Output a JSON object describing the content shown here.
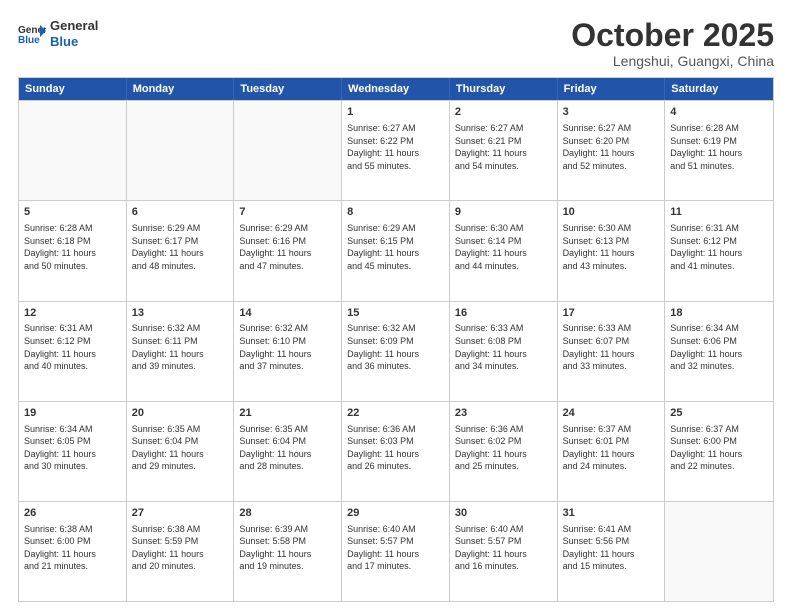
{
  "header": {
    "logo_line1": "General",
    "logo_line2": "Blue",
    "month_title": "October 2025",
    "location": "Lengshui, Guangxi, China"
  },
  "weekdays": [
    "Sunday",
    "Monday",
    "Tuesday",
    "Wednesday",
    "Thursday",
    "Friday",
    "Saturday"
  ],
  "rows": [
    [
      {
        "day": "",
        "info": ""
      },
      {
        "day": "",
        "info": ""
      },
      {
        "day": "",
        "info": ""
      },
      {
        "day": "1",
        "info": "Sunrise: 6:27 AM\nSunset: 6:22 PM\nDaylight: 11 hours\nand 55 minutes."
      },
      {
        "day": "2",
        "info": "Sunrise: 6:27 AM\nSunset: 6:21 PM\nDaylight: 11 hours\nand 54 minutes."
      },
      {
        "day": "3",
        "info": "Sunrise: 6:27 AM\nSunset: 6:20 PM\nDaylight: 11 hours\nand 52 minutes."
      },
      {
        "day": "4",
        "info": "Sunrise: 6:28 AM\nSunset: 6:19 PM\nDaylight: 11 hours\nand 51 minutes."
      }
    ],
    [
      {
        "day": "5",
        "info": "Sunrise: 6:28 AM\nSunset: 6:18 PM\nDaylight: 11 hours\nand 50 minutes."
      },
      {
        "day": "6",
        "info": "Sunrise: 6:29 AM\nSunset: 6:17 PM\nDaylight: 11 hours\nand 48 minutes."
      },
      {
        "day": "7",
        "info": "Sunrise: 6:29 AM\nSunset: 6:16 PM\nDaylight: 11 hours\nand 47 minutes."
      },
      {
        "day": "8",
        "info": "Sunrise: 6:29 AM\nSunset: 6:15 PM\nDaylight: 11 hours\nand 45 minutes."
      },
      {
        "day": "9",
        "info": "Sunrise: 6:30 AM\nSunset: 6:14 PM\nDaylight: 11 hours\nand 44 minutes."
      },
      {
        "day": "10",
        "info": "Sunrise: 6:30 AM\nSunset: 6:13 PM\nDaylight: 11 hours\nand 43 minutes."
      },
      {
        "day": "11",
        "info": "Sunrise: 6:31 AM\nSunset: 6:12 PM\nDaylight: 11 hours\nand 41 minutes."
      }
    ],
    [
      {
        "day": "12",
        "info": "Sunrise: 6:31 AM\nSunset: 6:12 PM\nDaylight: 11 hours\nand 40 minutes."
      },
      {
        "day": "13",
        "info": "Sunrise: 6:32 AM\nSunset: 6:11 PM\nDaylight: 11 hours\nand 39 minutes."
      },
      {
        "day": "14",
        "info": "Sunrise: 6:32 AM\nSunset: 6:10 PM\nDaylight: 11 hours\nand 37 minutes."
      },
      {
        "day": "15",
        "info": "Sunrise: 6:32 AM\nSunset: 6:09 PM\nDaylight: 11 hours\nand 36 minutes."
      },
      {
        "day": "16",
        "info": "Sunrise: 6:33 AM\nSunset: 6:08 PM\nDaylight: 11 hours\nand 34 minutes."
      },
      {
        "day": "17",
        "info": "Sunrise: 6:33 AM\nSunset: 6:07 PM\nDaylight: 11 hours\nand 33 minutes."
      },
      {
        "day": "18",
        "info": "Sunrise: 6:34 AM\nSunset: 6:06 PM\nDaylight: 11 hours\nand 32 minutes."
      }
    ],
    [
      {
        "day": "19",
        "info": "Sunrise: 6:34 AM\nSunset: 6:05 PM\nDaylight: 11 hours\nand 30 minutes."
      },
      {
        "day": "20",
        "info": "Sunrise: 6:35 AM\nSunset: 6:04 PM\nDaylight: 11 hours\nand 29 minutes."
      },
      {
        "day": "21",
        "info": "Sunrise: 6:35 AM\nSunset: 6:04 PM\nDaylight: 11 hours\nand 28 minutes."
      },
      {
        "day": "22",
        "info": "Sunrise: 6:36 AM\nSunset: 6:03 PM\nDaylight: 11 hours\nand 26 minutes."
      },
      {
        "day": "23",
        "info": "Sunrise: 6:36 AM\nSunset: 6:02 PM\nDaylight: 11 hours\nand 25 minutes."
      },
      {
        "day": "24",
        "info": "Sunrise: 6:37 AM\nSunset: 6:01 PM\nDaylight: 11 hours\nand 24 minutes."
      },
      {
        "day": "25",
        "info": "Sunrise: 6:37 AM\nSunset: 6:00 PM\nDaylight: 11 hours\nand 22 minutes."
      }
    ],
    [
      {
        "day": "26",
        "info": "Sunrise: 6:38 AM\nSunset: 6:00 PM\nDaylight: 11 hours\nand 21 minutes."
      },
      {
        "day": "27",
        "info": "Sunrise: 6:38 AM\nSunset: 5:59 PM\nDaylight: 11 hours\nand 20 minutes."
      },
      {
        "day": "28",
        "info": "Sunrise: 6:39 AM\nSunset: 5:58 PM\nDaylight: 11 hours\nand 19 minutes."
      },
      {
        "day": "29",
        "info": "Sunrise: 6:40 AM\nSunset: 5:57 PM\nDaylight: 11 hours\nand 17 minutes."
      },
      {
        "day": "30",
        "info": "Sunrise: 6:40 AM\nSunset: 5:57 PM\nDaylight: 11 hours\nand 16 minutes."
      },
      {
        "day": "31",
        "info": "Sunrise: 6:41 AM\nSunset: 5:56 PM\nDaylight: 11 hours\nand 15 minutes."
      },
      {
        "day": "",
        "info": ""
      }
    ]
  ]
}
